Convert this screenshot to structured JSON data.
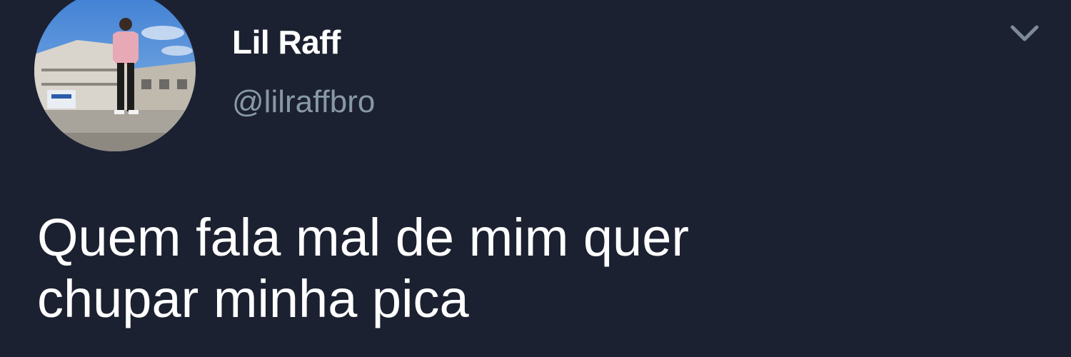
{
  "user": {
    "display_name": "Lil Raff",
    "handle": "@lilraffbro"
  },
  "tweet": {
    "lines": [
      "Quem fala mal de mim quer",
      "chupar minha pica"
    ]
  },
  "icons": {
    "menu": "chevron-down-icon",
    "avatar": "avatar"
  },
  "colors": {
    "background": "#1c2131",
    "text": "#ffffff",
    "secondary_text": "#8899a6"
  }
}
